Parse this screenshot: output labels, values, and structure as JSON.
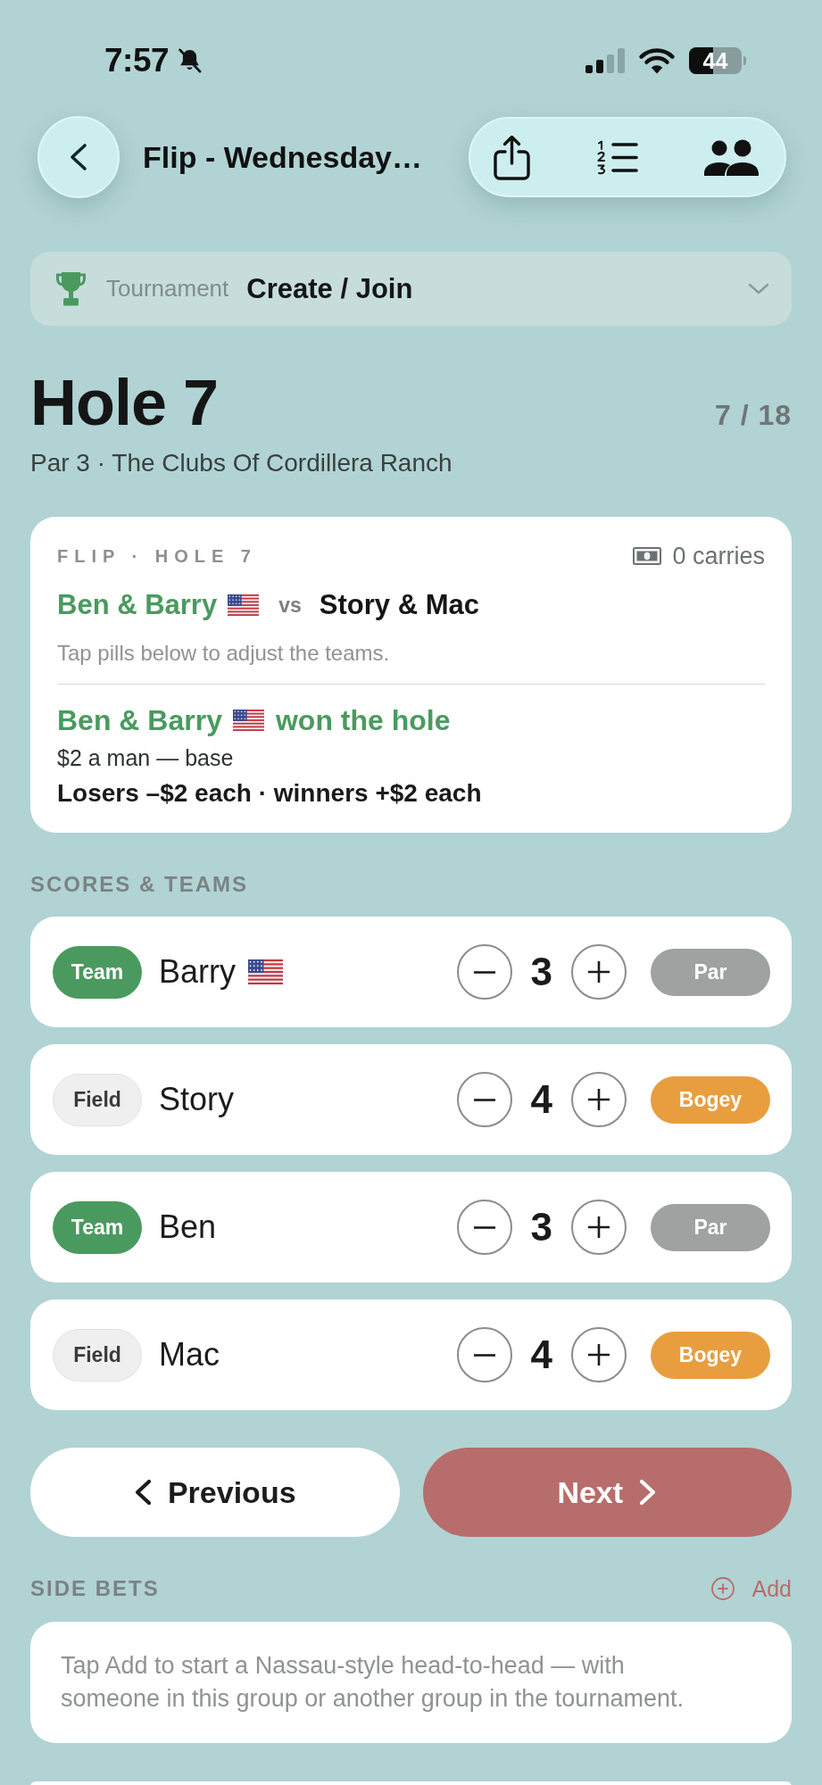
{
  "status_bar": {
    "time": "7:57",
    "battery": "44"
  },
  "nav": {
    "title": "Flip - Wednesday…"
  },
  "tournament": {
    "label": "Tournament",
    "value": "Create / Join"
  },
  "hole": {
    "title": "Hole 7",
    "progress": "7 / 18",
    "subtitle": "Par 3 · The Clubs Of Cordillera Ranch"
  },
  "game_card": {
    "heading": "FLIP · HOLE 7",
    "carries": "0 carries",
    "team_a": {
      "name": "Ben & Barry",
      "flag": true
    },
    "vs": "vs",
    "team_b": {
      "name": "Story & Mac"
    },
    "hint": "Tap pills below to adjust the teams.",
    "result": {
      "winner": "Ben & Barry",
      "flag": true,
      "text": "won the hole"
    },
    "stake": "$2 a man — base",
    "payout": "Losers –$2 each · winners +$2 each"
  },
  "scores": {
    "title": "SCORES & TEAMS",
    "players": [
      {
        "side": {
          "label": "Team",
          "selected": true
        },
        "name": "Barry",
        "flag": true,
        "score": "3",
        "result": {
          "label": "Par",
          "color": "#9ea2a1"
        }
      },
      {
        "side": {
          "label": "Field",
          "selected": false
        },
        "name": "Story",
        "flag": false,
        "score": "4",
        "result": {
          "label": "Bogey",
          "color": "#e89e3f"
        }
      },
      {
        "side": {
          "label": "Team",
          "selected": true
        },
        "name": "Ben",
        "flag": false,
        "score": "3",
        "result": {
          "label": "Par",
          "color": "#9ea2a1"
        }
      },
      {
        "side": {
          "label": "Field",
          "selected": false
        },
        "name": "Mac",
        "flag": false,
        "score": "4",
        "result": {
          "label": "Bogey",
          "color": "#e89e3f"
        }
      }
    ]
  },
  "buttons": [
    {
      "label": "Previous",
      "kind": "back"
    },
    {
      "label": "Next",
      "kind": "forward"
    }
  ],
  "side_bets": {
    "title": "SIDE BETS",
    "action": "Add",
    "empty_text": "Tap Add to start a Nassau-style head-to-head — with someone in this group or another group in the tournament."
  }
}
